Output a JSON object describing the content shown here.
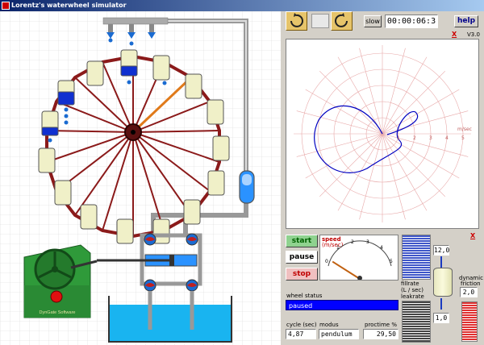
{
  "window": {
    "title": "Lorentz's waterwheel simulator"
  },
  "toolbar": {
    "rotate_ccw_icon": "rotate-ccw-icon",
    "rotate_cw_icon": "rotate-cw-icon",
    "slow_label": "slow",
    "timer": "00:00:06:3",
    "help_label": "help",
    "version": "V3.0",
    "close_mark": "X"
  },
  "phase_plot": {
    "axis_label": "m/sec",
    "ticks": [
      "1",
      "2",
      "3",
      "4",
      "5"
    ],
    "grid_color": "#e08080",
    "trace_color": "#0000c0"
  },
  "controls": {
    "start_label": "start",
    "pause_label": "pause",
    "stop_label": "stop",
    "close_mark": "X"
  },
  "speed_meter": {
    "title": "speed",
    "unit": "(m/sec)",
    "ticks": [
      "0",
      "1",
      "2",
      "3",
      "4",
      "5"
    ],
    "value": 0.9
  },
  "rates": {
    "fillrate_label": "fillrate",
    "unit_label": "(L / sec)",
    "leakrate_label": "leakrate",
    "fillrate_value": "12,0",
    "leakrate_value": "1,0"
  },
  "friction": {
    "label_line1": "dynamic",
    "label_line2": "friction",
    "value": "2,0"
  },
  "status": {
    "label": "wheel status",
    "value": "paused"
  },
  "readouts": {
    "cycle_label": "cycle (sec)",
    "cycle_value": "4,87",
    "modus_label": "modus",
    "modus_value": "pendulum",
    "proctime_label": "proctime %",
    "proctime_value": "29,50"
  },
  "scene": {
    "logo_text": "DynGate Software"
  }
}
